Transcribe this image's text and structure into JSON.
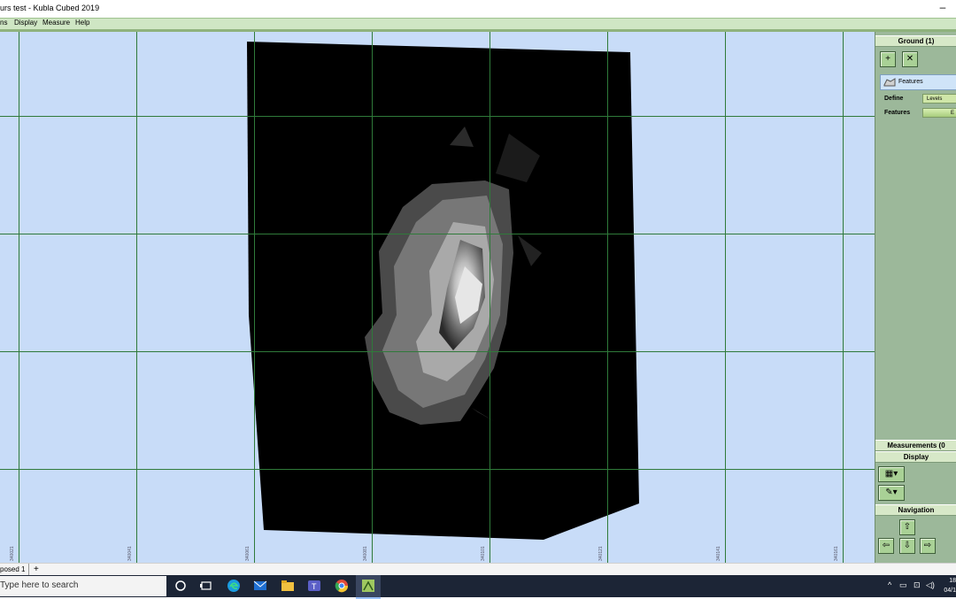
{
  "window": {
    "title": "urs test - Kubla Cubed 2019"
  },
  "menu": {
    "items": [
      "ns",
      "Display",
      "Measure",
      "Help"
    ]
  },
  "viewport": {
    "x_tick_labels": [
      "340021",
      "340041",
      "340061",
      "340081",
      "340101",
      "340121",
      "340141",
      "340161"
    ]
  },
  "panel": {
    "ground_header": "Ground (1)",
    "add_label": "+",
    "delete_label": "✕",
    "features_item": "Features",
    "define_label": "Define",
    "define_value": "Levels",
    "features_label": "Features",
    "features_value": "E",
    "measurements_header": "Measurements (0",
    "display_header": "Display",
    "navigation_header": "Navigation"
  },
  "tabs": {
    "items": [
      "posed 1"
    ],
    "add_label": "+"
  },
  "taskbar": {
    "search_placeholder": "Type here to search",
    "clock_time": "18",
    "clock_date": "04/1"
  },
  "colors": {
    "viewport_bg": "#c8dcf8",
    "grid": "#2f7a3a",
    "panel_bg": "#9cb89a",
    "menubar_bg": "#cfe6c4",
    "taskbar_bg": "#1c2536"
  },
  "icons": [
    "plus-icon",
    "close-icon",
    "features-icon",
    "display-layer-icon",
    "display-paint-icon",
    "arrow-up-icon",
    "arrow-left-icon",
    "arrow-down-icon",
    "arrow-right-icon",
    "start-icon",
    "task-view-icon",
    "edge-icon",
    "mail-icon",
    "file-explorer-icon",
    "teams-icon",
    "chrome-icon",
    "kubla-icon"
  ]
}
